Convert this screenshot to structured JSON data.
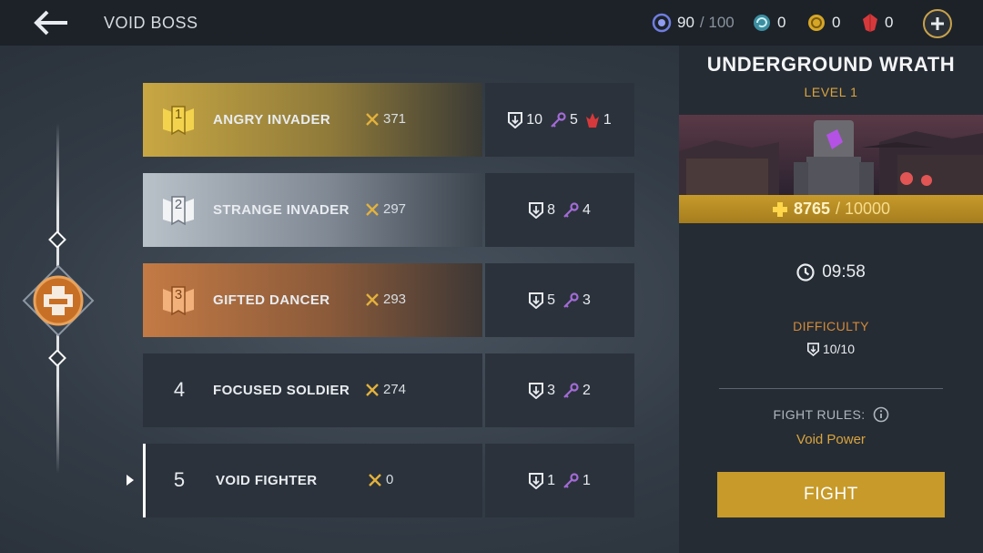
{
  "header": {
    "title": "VOID BOSS",
    "energy": {
      "current": "90",
      "max": "/ 100"
    },
    "orbs": "0",
    "coins": "0",
    "gems": "0"
  },
  "leaderboard": [
    {
      "rank": "1",
      "name": "ANGRY INVADER",
      "score": "371",
      "rewards": {
        "tickets": "10",
        "keys": "5",
        "shards": "1"
      }
    },
    {
      "rank": "2",
      "name": "STRANGE INVADER",
      "score": "297",
      "rewards": {
        "tickets": "8",
        "keys": "4"
      }
    },
    {
      "rank": "3",
      "name": "GIFTED DANCER",
      "score": "293",
      "rewards": {
        "tickets": "5",
        "keys": "3"
      }
    },
    {
      "rank": "4",
      "name": "FOCUSED SOLDIER",
      "score": "274",
      "rewards": {
        "tickets": "3",
        "keys": "2"
      }
    },
    {
      "rank": "5",
      "name": "VOID FIGHTER",
      "score": "0",
      "rewards": {
        "tickets": "1",
        "keys": "1"
      }
    }
  ],
  "boss": {
    "name": "UNDERGROUND WRATH",
    "level": "LEVEL 1",
    "hp_current": "8765",
    "hp_max": "/ 10000",
    "timer": "09:58",
    "difficulty_label": "DIFFICULTY",
    "difficulty_value": "10/10",
    "rules_label": "FIGHT RULES:",
    "rules_value": "Void Power",
    "fight_label": "FIGHT"
  },
  "colors": {
    "gold": "#c79a2a",
    "silver": "#b9c1c9",
    "bronze": "#c47a44",
    "accent_orange": "#d28a3a",
    "key_purple": "#a46bd8",
    "shard_red": "#d6393b"
  }
}
